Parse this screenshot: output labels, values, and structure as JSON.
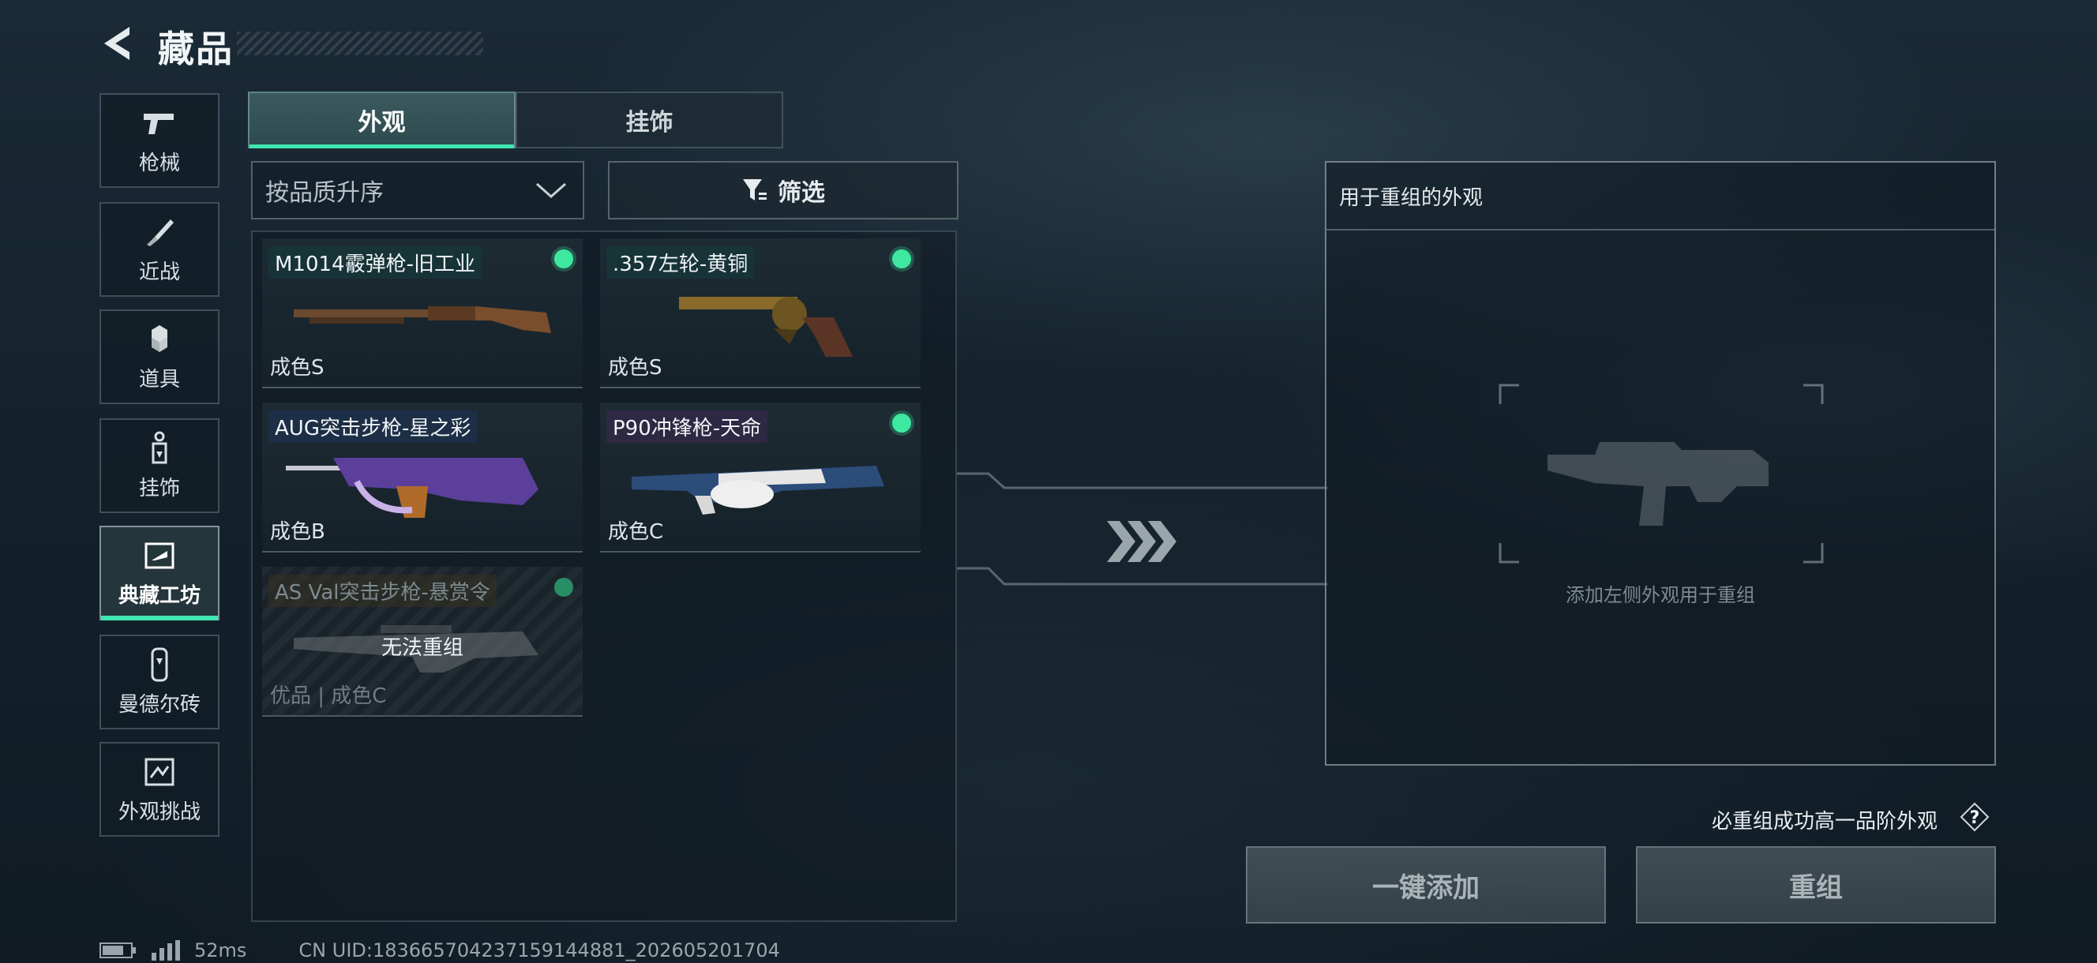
{
  "header": {
    "title": "藏品"
  },
  "sidebar": {
    "items": [
      {
        "label": "枪械",
        "icon": "pistol-icon"
      },
      {
        "label": "近战",
        "icon": "knife-icon"
      },
      {
        "label": "道具",
        "icon": "grenade-icon"
      },
      {
        "label": "挂饰",
        "icon": "charm-icon"
      },
      {
        "label": "典藏工坊",
        "icon": "workshop-icon",
        "active": true
      },
      {
        "label": "曼德尔砖",
        "icon": "brick-icon"
      },
      {
        "label": "外观挑战",
        "icon": "challenge-icon"
      }
    ]
  },
  "tabs": [
    {
      "label": "外观",
      "active": true
    },
    {
      "label": "挂饰",
      "active": false
    }
  ],
  "sort": {
    "label": "按品质升序"
  },
  "filter": {
    "label": "筛选"
  },
  "skins": [
    {
      "name": "M1014霰弹枪-旧工业",
      "grade": "成色S",
      "ready": true
    },
    {
      "name": ".357左轮-黄铜",
      "grade": "成色S",
      "ready": true
    },
    {
      "name": "AUG突击步枪-星之彩",
      "grade": "成色B",
      "ready": false
    },
    {
      "name": "P90冲锋枪-天命",
      "grade": "成色C",
      "ready": true
    },
    {
      "name": "AS Val突击步枪-悬赏令",
      "grade": "优品 | 成色C",
      "blocked_label": "无法重组",
      "ready": true
    }
  ],
  "recompose": {
    "title": "用于重组的外观",
    "hint": "添加左侧外观用于重组"
  },
  "guarantee_note": "必重组成功高一品阶外观",
  "buttons": {
    "add_all": "一键添加",
    "recompose": "重组"
  },
  "footer": {
    "ping": "52ms",
    "uid": "CN UID:1836657042371591448​81_202605201704"
  },
  "colors": {
    "accent": "#3fe6b0",
    "ready_dot": "#3ee8a0"
  }
}
